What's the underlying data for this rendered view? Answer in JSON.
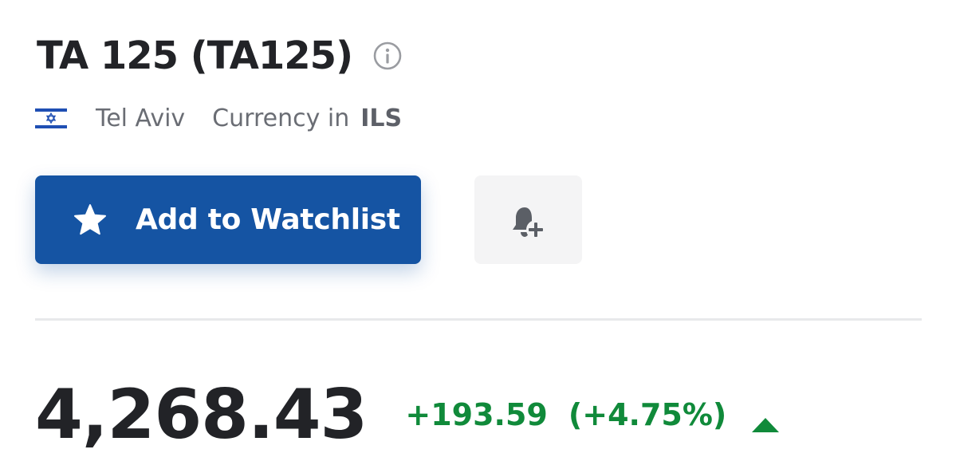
{
  "header": {
    "title": "TA 125 (TA125)",
    "info_icon": "info-circle-icon"
  },
  "meta": {
    "flag_icon": "israel-flag-icon",
    "exchange": "Tel Aviv",
    "currency_label": "Currency in",
    "currency_code": "ILS"
  },
  "actions": {
    "watchlist_label": "Add to Watchlist",
    "watchlist_icon": "star-icon",
    "alert_icon": "bell-plus-icon"
  },
  "quote": {
    "price": "4,268.43",
    "change": "+193.59",
    "change_pct": "(+4.75%)",
    "direction_icon": "triangle-up-icon"
  },
  "colors": {
    "primary": "#1554a3",
    "positive": "#108a3a",
    "text_dark": "#222327",
    "text_muted": "#6a6d74"
  }
}
